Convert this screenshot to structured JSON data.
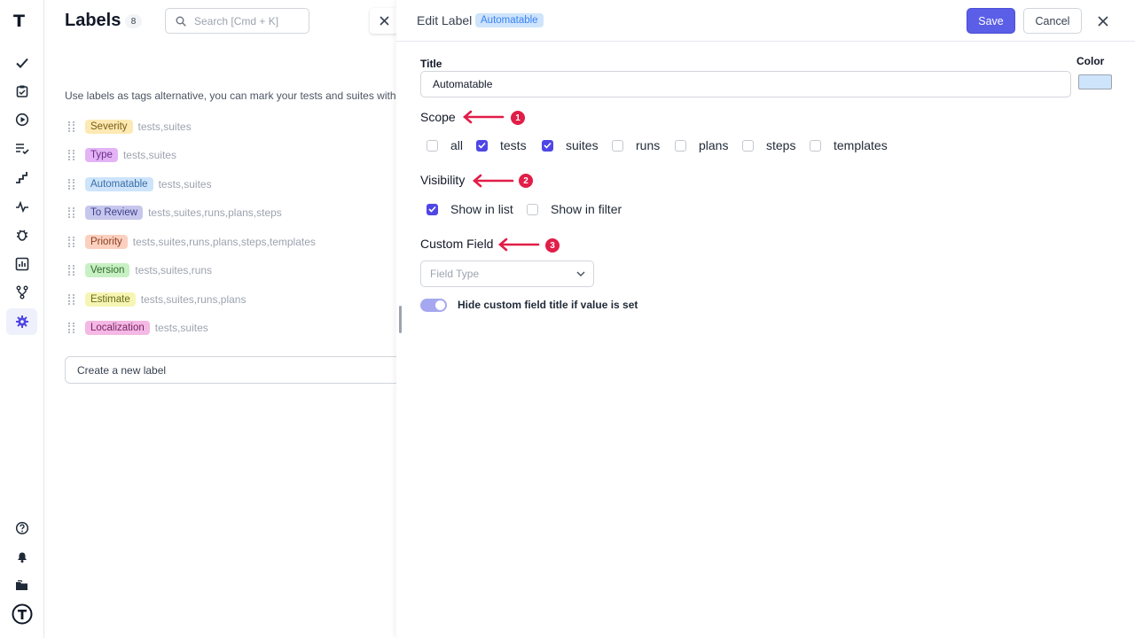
{
  "app": {
    "logo": "T"
  },
  "rail": {
    "items": [
      {
        "icon": "check-icon"
      },
      {
        "icon": "clipboard-check-icon"
      },
      {
        "icon": "play-circle-icon"
      },
      {
        "icon": "list-check-icon"
      },
      {
        "icon": "steps-icon"
      },
      {
        "icon": "pulse-icon"
      },
      {
        "icon": "bug-icon"
      },
      {
        "icon": "chart-icon"
      },
      {
        "icon": "branch-icon"
      },
      {
        "icon": "gear-icon",
        "active": true
      },
      {
        "icon": "help-icon"
      },
      {
        "icon": "bell-icon"
      },
      {
        "icon": "folders-icon"
      },
      {
        "icon": "user-avatar-icon"
      }
    ]
  },
  "labels_page": {
    "title": "Labels",
    "count": "8",
    "search_placeholder": "Search [Cmd + K]",
    "description": "Use labels as tags alternative, you can mark your tests and suites with",
    "labels": [
      {
        "name": "Severity",
        "scope": "tests,suites",
        "bg": "#fde9b3",
        "fg": "#7a5c12"
      },
      {
        "name": "Type",
        "scope": "tests,suites",
        "bg": "#e3b3f5",
        "fg": "#6b2d8a"
      },
      {
        "name": "Automatable",
        "scope": "tests,suites",
        "bg": "#cde4fb",
        "fg": "#3b6ea5"
      },
      {
        "name": "To Review",
        "scope": "tests,suites,runs,plans,steps",
        "bg": "#c7c7ee",
        "fg": "#3f3f8a"
      },
      {
        "name": "Priority",
        "scope": "tests,suites,runs,plans,steps,templates",
        "bg": "#fbd0bf",
        "fg": "#8a3f22"
      },
      {
        "name": "Version",
        "scope": "tests,suites,runs",
        "bg": "#c8f0c4",
        "fg": "#2f6b2a"
      },
      {
        "name": "Estimate",
        "scope": "tests,suites,runs,plans",
        "bg": "#f6f5b3",
        "fg": "#6b6a1a"
      },
      {
        "name": "Localization",
        "scope": "tests,suites",
        "bg": "#f3b8e3",
        "fg": "#7a2466"
      }
    ],
    "new_label_placeholder": "Create a new label"
  },
  "drawer": {
    "title": "Edit Label",
    "badge": "Automatable",
    "save_label": "Save",
    "cancel_label": "Cancel",
    "title_label": "Title",
    "title_value": "Automatable",
    "color_label": "Color",
    "color_value": "#cde4fb",
    "scope": {
      "heading": "Scope",
      "marker": "1",
      "options": [
        {
          "label": "all",
          "checked": false
        },
        {
          "label": "tests",
          "checked": true
        },
        {
          "label": "suites",
          "checked": true
        },
        {
          "label": "runs",
          "checked": false
        },
        {
          "label": "plans",
          "checked": false
        },
        {
          "label": "steps",
          "checked": false
        },
        {
          "label": "templates",
          "checked": false
        }
      ]
    },
    "visibility": {
      "heading": "Visibility",
      "marker": "2",
      "options": [
        {
          "label": "Show in list",
          "checked": true
        },
        {
          "label": "Show in filter",
          "checked": false
        }
      ]
    },
    "custom_field": {
      "heading": "Custom Field",
      "marker": "3",
      "field_type_placeholder": "Field Type",
      "toggle_label": "Hide custom field title if value is set",
      "toggle_on": true
    }
  },
  "colors": {
    "accent": "#5b5ee6",
    "annotation": "#e11d48"
  }
}
